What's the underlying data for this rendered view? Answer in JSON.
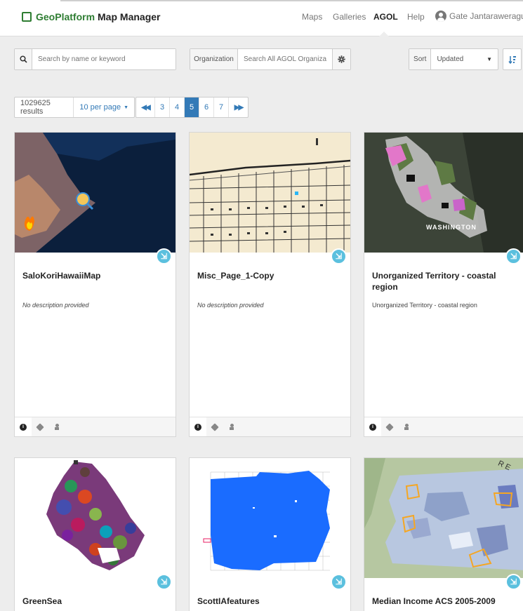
{
  "navbar": {
    "brand_geo": "GeoPlatform",
    "brand_rest": "Map Manager",
    "links": [
      "Maps",
      "Galleries",
      "AGOL",
      "Help"
    ],
    "active_link": "AGOL",
    "user_name": "Gate Jantaraweragul",
    "user_caret": "▾"
  },
  "search": {
    "icon": "search-icon",
    "placeholder": "Search by name or keyword"
  },
  "organization": {
    "label": "Organization",
    "placeholder": "Search All AGOL Organization",
    "gear_icon": "gear-icon"
  },
  "sort": {
    "label": "Sort",
    "selected": "Updated",
    "direction_icon": "sort-direction-icon"
  },
  "results": {
    "count_text": "1029625 results",
    "per_page": "10 per page"
  },
  "pagination": {
    "first": "◀◀",
    "pages": [
      "3",
      "4",
      "5",
      "6",
      "7"
    ],
    "current": "5",
    "last": "▶▶"
  },
  "cards": [
    {
      "title": "SaloKoriHawaiiMap",
      "description": "No description provided",
      "desc_italic": true
    },
    {
      "title": "Misc_Page_1-Copy",
      "description": "No description provided",
      "desc_italic": true
    },
    {
      "title": "Unorganized Territory - coastal region",
      "description": "Unorganized Territory - coastal region",
      "desc_italic": false,
      "map_label": "WASHINGTON"
    },
    {
      "title": "GreenSea"
    },
    {
      "title": "ScottIAfeatures"
    },
    {
      "title": "Median Income ACS 2005-2009"
    }
  ],
  "card_tabs": {
    "info": "i"
  },
  "colors": {
    "brand_green": "#2e7d32",
    "link_blue": "#337ab7",
    "open_button": "#5bc0de"
  }
}
